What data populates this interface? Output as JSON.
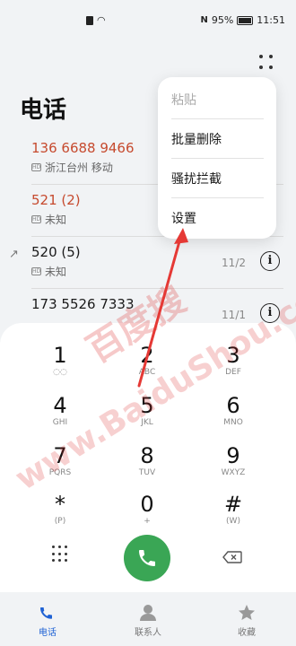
{
  "status_bar": {
    "battery": "95%",
    "time": "11:51",
    "nfc": "N"
  },
  "page_title": "电话",
  "call_log": [
    {
      "number": "136 6688 9466",
      "count": "",
      "location": "浙江台州 移动",
      "missed": true,
      "date": "",
      "outgoing": false
    },
    {
      "number": "521 (2)",
      "count": "",
      "location": "未知",
      "missed": true,
      "date": "",
      "outgoing": false
    },
    {
      "number": "520 (5)",
      "count": "",
      "location": "未知",
      "missed": false,
      "date": "11/2",
      "outgoing": true
    },
    {
      "number": "173 5526 7333",
      "count": "",
      "location": "",
      "missed": false,
      "date": "11/1",
      "outgoing": false
    }
  ],
  "menu": {
    "paste": "粘贴",
    "batch_delete": "批量删除",
    "block": "骚扰拦截",
    "settings": "设置"
  },
  "watermark": {
    "cn": "百度搜",
    "en": "www.BaiduShou.com"
  },
  "keypad": [
    {
      "digit": "1",
      "letters": "◌◌"
    },
    {
      "digit": "2",
      "letters": "ABC"
    },
    {
      "digit": "3",
      "letters": "DEF"
    },
    {
      "digit": "4",
      "letters": "GHI"
    },
    {
      "digit": "5",
      "letters": "JKL"
    },
    {
      "digit": "6",
      "letters": "MNO"
    },
    {
      "digit": "7",
      "letters": "PQRS"
    },
    {
      "digit": "8",
      "letters": "TUV"
    },
    {
      "digit": "9",
      "letters": "WXYZ"
    },
    {
      "digit": "*",
      "letters": "(P)"
    },
    {
      "digit": "0",
      "letters": "+"
    },
    {
      "digit": "#",
      "letters": "(W)"
    }
  ],
  "nav": {
    "phone": "电话",
    "contacts": "联系人",
    "favorites": "收藏"
  },
  "colors": {
    "accent": "#1f62d4",
    "missed": "#c64a2e",
    "call_green": "#3aa655",
    "arrow": "#e53935"
  }
}
